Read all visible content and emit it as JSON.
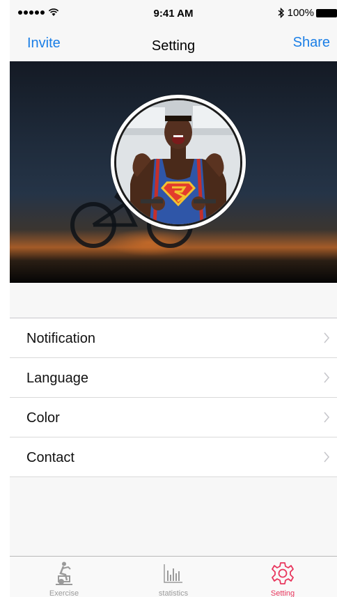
{
  "status_bar": {
    "time": "9:41 AM",
    "wifi_icon": "wifi-icon",
    "bluetooth_icon": "bluetooth-icon",
    "battery": "100%"
  },
  "nav": {
    "left": "Invite",
    "title": "Setting",
    "right": "Share"
  },
  "hero": {
    "avatar_icon": "profile-photo"
  },
  "settings": [
    {
      "label": "Notification",
      "icon": "chevron-right-icon"
    },
    {
      "label": "Language",
      "icon": "chevron-right-icon"
    },
    {
      "label": "Color",
      "icon": "chevron-right-icon"
    },
    {
      "label": "Contact",
      "icon": "chevron-right-icon"
    }
  ],
  "tabs": [
    {
      "label": "Exercise",
      "icon": "exercise-bike-icon"
    },
    {
      "label": "statistics",
      "icon": "bar-chart-icon"
    },
    {
      "label": "Setting",
      "icon": "gear-icon",
      "active": true
    }
  ],
  "colors": {
    "accent": "#1a7ee6",
    "active_tab": "#e8365d",
    "inactive_tab": "#9a9a9a"
  }
}
